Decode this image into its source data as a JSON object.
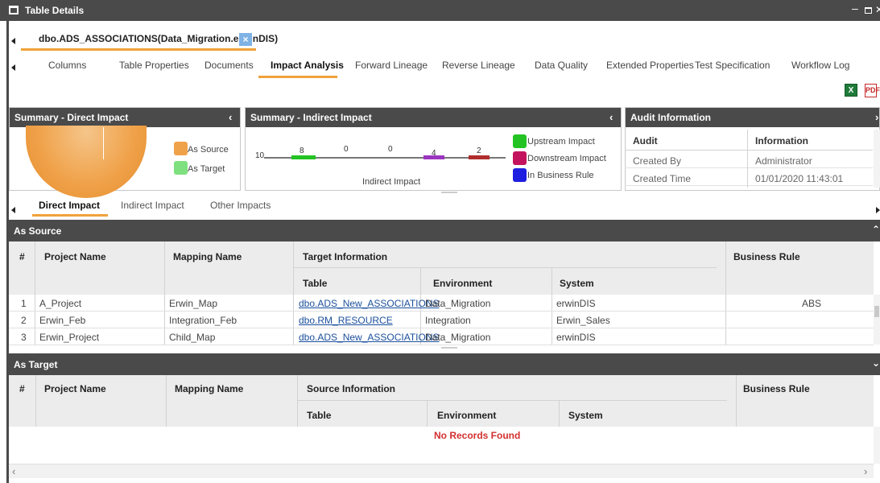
{
  "window": {
    "title": "Table Details"
  },
  "document_tab": {
    "label": "dbo.ADS_ASSOCIATIONS(Data_Migration.erwinDIS)",
    "close_glyph": "×"
  },
  "tabs": [
    {
      "label": "Columns",
      "active": false
    },
    {
      "label": "Table Properties",
      "active": false
    },
    {
      "label": "Documents",
      "active": false
    },
    {
      "label": "Impact Analysis",
      "active": true
    },
    {
      "label": "Forward Lineage",
      "active": false
    },
    {
      "label": "Reverse Lineage",
      "active": false
    },
    {
      "label": "Data Quality",
      "active": false
    },
    {
      "label": "Extended Properties",
      "active": false
    },
    {
      "label": "Test Specification",
      "active": false
    },
    {
      "label": "Workflow Log",
      "active": false
    }
  ],
  "exports": {
    "excel_icon": "excel-export-icon",
    "pdf_icon": "pdf-export-icon"
  },
  "summary_direct": {
    "title": "Summary - Direct Impact",
    "legend": [
      {
        "label": "As Source",
        "color": "#f0a24a"
      },
      {
        "label": "As Target",
        "color": "#7fe07f"
      }
    ]
  },
  "summary_indirect": {
    "title": "Summary - Indirect Impact",
    "chart_caption": "Indirect Impact",
    "axis_start_label": "10",
    "values": [
      "8",
      "0",
      "0",
      "4",
      "2"
    ],
    "legend": [
      {
        "label": "Upstream Impact",
        "color": "#22c322"
      },
      {
        "label": "Downstream Impact",
        "color": "#c4135e"
      },
      {
        "label": "In Business Rule",
        "color": "#1e1ee0"
      }
    ]
  },
  "audit": {
    "title": "Audit Information",
    "headers": {
      "audit": "Audit",
      "information": "Information"
    },
    "rows": [
      {
        "audit": "Created By",
        "information": "Administrator"
      },
      {
        "audit": "Created Time",
        "information": "01/01/2020 11:43:01"
      }
    ]
  },
  "subtabs": [
    {
      "label": "Direct Impact",
      "active": true
    },
    {
      "label": "Indirect Impact",
      "active": false
    },
    {
      "label": "Other Impacts",
      "active": false
    }
  ],
  "as_source": {
    "title": "As Source",
    "headers": {
      "num": "#",
      "project": "Project Name",
      "mapping": "Mapping Name",
      "group": "Target Information",
      "table": "Table",
      "environment": "Environment",
      "system": "System",
      "business_rule": "Business Rule"
    },
    "rows": [
      {
        "num": "1",
        "project": "A_Project",
        "mapping": "Erwin_Map",
        "table": "dbo.ADS_New_ASSOCIATIONS",
        "environment": "Data_Migration",
        "system": "erwinDIS",
        "business_rule": "ABS"
      },
      {
        "num": "2",
        "project": "Erwin_Feb",
        "mapping": "Integration_Feb",
        "table": "dbo.RM_RESOURCE",
        "environment": "Integration",
        "system": "Erwin_Sales",
        "business_rule": ""
      },
      {
        "num": "3",
        "project": "Erwin_Project",
        "mapping": "Child_Map",
        "table": "dbo.ADS_New_ASSOCIATIONS",
        "environment": "Data_Migration",
        "system": "erwinDIS",
        "business_rule": ""
      }
    ]
  },
  "as_target": {
    "title": "As Target",
    "headers": {
      "num": "#",
      "project": "Project Name",
      "mapping": "Mapping Name",
      "group": "Source Information",
      "table": "Table",
      "environment": "Environment",
      "system": "System",
      "business_rule": "Business Rule"
    },
    "empty_message": "No Records Found"
  }
}
